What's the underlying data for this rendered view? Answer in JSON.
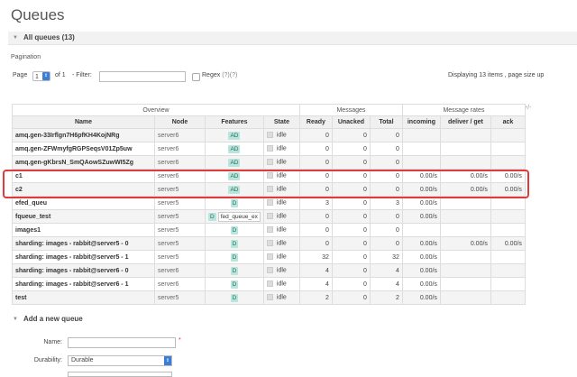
{
  "page_title": "Queues",
  "all_queues_header": "All queues (13)",
  "pagination": {
    "label": "Pagination",
    "page_label": "Page",
    "page_value": "1",
    "of_label": "of 1",
    "filter_label": "- Filter:",
    "filter_value": "",
    "regex_label": "Regex",
    "regex_help": "(?)(?)",
    "display_text": "Displaying 13 items , page size up"
  },
  "table": {
    "groups": [
      "Overview",
      "Messages",
      "Message rates"
    ],
    "plus_minus": "+/-",
    "columns": [
      "Name",
      "Node",
      "Features",
      "State",
      "Ready",
      "Unacked",
      "Total",
      "incoming",
      "deliver / get",
      "ack"
    ],
    "rows": [
      {
        "name": "amq.gen-33Irflgn7H6pfKH4KojNRg",
        "node": "server6",
        "feature": "AD",
        "extra": "",
        "state": "idle",
        "ready": "0",
        "unacked": "0",
        "total": "0",
        "incoming": "",
        "deliver": "",
        "ack": ""
      },
      {
        "name": "amq.gen-ZFWmyfgRGPSeqsV01Zp5uw",
        "node": "server6",
        "feature": "AD",
        "extra": "",
        "state": "idle",
        "ready": "0",
        "unacked": "0",
        "total": "0",
        "incoming": "",
        "deliver": "",
        "ack": ""
      },
      {
        "name": "amq.gen-gKbrsN_SmQAowSZuwWI5Zg",
        "node": "server6",
        "feature": "AD",
        "extra": "",
        "state": "idle",
        "ready": "0",
        "unacked": "0",
        "total": "0",
        "incoming": "",
        "deliver": "",
        "ack": ""
      },
      {
        "name": "c1",
        "node": "server6",
        "feature": "AD",
        "extra": "",
        "state": "idle",
        "ready": "0",
        "unacked": "0",
        "total": "0",
        "incoming": "0.00/s",
        "deliver": "0.00/s",
        "ack": "0.00/s"
      },
      {
        "name": "c2",
        "node": "server5",
        "feature": "AD",
        "extra": "",
        "state": "idle",
        "ready": "0",
        "unacked": "0",
        "total": "0",
        "incoming": "0.00/s",
        "deliver": "0.00/s",
        "ack": "0.00/s"
      },
      {
        "name": "efed_queu",
        "node": "server5",
        "feature": "D",
        "extra": "",
        "state": "idle",
        "ready": "3",
        "unacked": "0",
        "total": "3",
        "incoming": "0.00/s",
        "deliver": "",
        "ack": ""
      },
      {
        "name": "fqueue_test",
        "node": "server5",
        "feature": "D",
        "extra": "fed_queue_ex",
        "state": "idle",
        "ready": "0",
        "unacked": "0",
        "total": "0",
        "incoming": "0.00/s",
        "deliver": "",
        "ack": ""
      },
      {
        "name": "images1",
        "node": "server5",
        "feature": "D",
        "extra": "",
        "state": "idle",
        "ready": "0",
        "unacked": "0",
        "total": "0",
        "incoming": "",
        "deliver": "",
        "ack": ""
      },
      {
        "name": "sharding: images - rabbit@server5 - 0",
        "node": "server5",
        "feature": "D",
        "extra": "",
        "state": "idle",
        "ready": "0",
        "unacked": "0",
        "total": "0",
        "incoming": "0.00/s",
        "deliver": "0.00/s",
        "ack": "0.00/s"
      },
      {
        "name": "sharding: images - rabbit@server5 - 1",
        "node": "server5",
        "feature": "D",
        "extra": "",
        "state": "idle",
        "ready": "32",
        "unacked": "0",
        "total": "32",
        "incoming": "0.00/s",
        "deliver": "",
        "ack": ""
      },
      {
        "name": "sharding: images - rabbit@server6 - 0",
        "node": "server6",
        "feature": "D",
        "extra": "",
        "state": "idle",
        "ready": "4",
        "unacked": "0",
        "total": "4",
        "incoming": "0.00/s",
        "deliver": "",
        "ack": ""
      },
      {
        "name": "sharding: images - rabbit@server6 - 1",
        "node": "server6",
        "feature": "D",
        "extra": "",
        "state": "idle",
        "ready": "4",
        "unacked": "0",
        "total": "4",
        "incoming": "0.00/s",
        "deliver": "",
        "ack": ""
      },
      {
        "name": "test",
        "node": "server5",
        "feature": "D",
        "extra": "",
        "state": "idle",
        "ready": "2",
        "unacked": "0",
        "total": "2",
        "incoming": "0.00/s",
        "deliver": "",
        "ack": ""
      }
    ]
  },
  "add_queue": {
    "header": "Add a new queue",
    "name_label": "Name:",
    "name_value": "",
    "required_mark": "*",
    "durability_label": "Durability:",
    "durability_value": "Durable"
  },
  "colors": {
    "highlight": "#e13a3a",
    "badge": "#b8e6dd",
    "select_accent": "#3b7ed8"
  }
}
